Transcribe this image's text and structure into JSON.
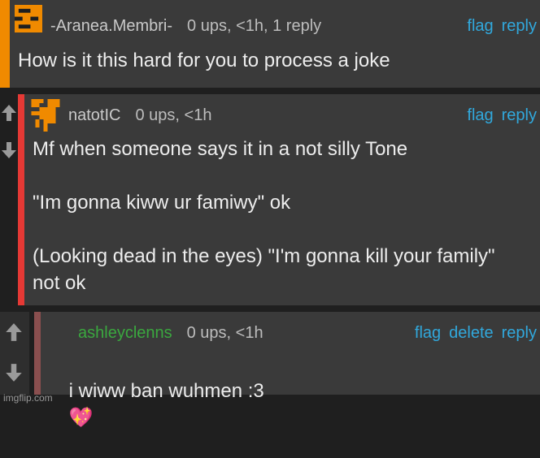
{
  "comments": [
    {
      "username": "-Aranea.Membri-",
      "meta": "0 ups, <1h, 1 reply",
      "actions": [
        "flag",
        "reply"
      ],
      "body": "How is it this hard for you to process a joke",
      "bar_color": "#f08a00"
    },
    {
      "username": "natotIC",
      "meta": "0 ups, <1h",
      "actions": [
        "flag",
        "reply"
      ],
      "body": "Mf when someone says it in a not silly Tone\n\n\"Im gonna kiww ur famiwy\" ok\n\n(Looking dead in the eyes) \"I'm gonna kill your family\" not ok",
      "bar_color": "#e53935"
    },
    {
      "username": "ashleyclenns",
      "meta": "0 ups, <1h",
      "actions": [
        "flag",
        "delete",
        "reply"
      ],
      "body": "i wiww ban wuhmen :3",
      "emoji": "💖",
      "bar_color": "#8a4f4f",
      "username_color": "#3aa83f"
    }
  ],
  "colors": {
    "link": "#31a8dc",
    "avatar_orange": "#f08a00",
    "panel": "#3a3a3a"
  },
  "icons": [
    "upvote-arrow-icon",
    "downvote-arrow-icon",
    "user-avatar-icon",
    "sparkling-heart-emoji"
  ],
  "watermark": "imgflip.com"
}
